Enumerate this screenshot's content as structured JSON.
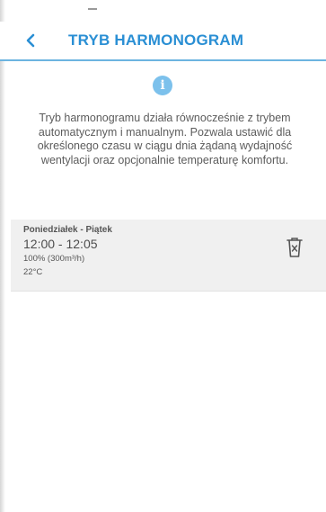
{
  "header": {
    "title": "TRYB HARMONOGRAM",
    "back_icon": "chevron-left-icon",
    "accent_color": "#2a8fd4"
  },
  "info": {
    "icon": "info-icon",
    "description": "Tryb harmonogramu działa równocześnie z trybem automatycznym i manualnym. Pozwala ustawić dla określonego czasu w ciągu dnia żądaną wydajność wentylacji oraz opcjonalnie temperaturę komfortu."
  },
  "schedules": [
    {
      "days": "Poniedziałek - Piątek",
      "time": "12:00 - 12:05",
      "airflow": "100% (300m³/h)",
      "temperature": "22°C",
      "delete_icon": "trash-icon"
    }
  ]
}
